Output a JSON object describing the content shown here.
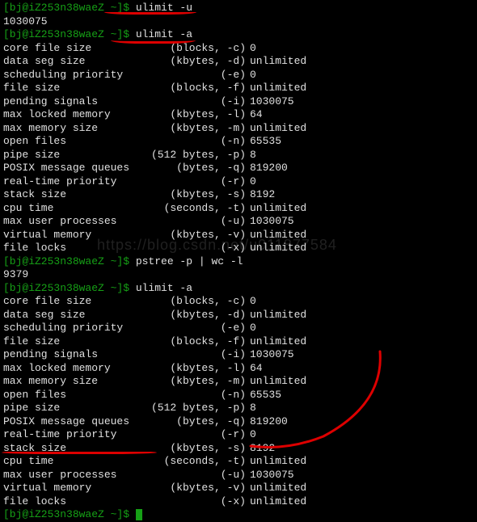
{
  "watermark_text": "https://blog.csdn.net/u011877584",
  "prompts": {
    "p1": {
      "host": "[bj@iZ253n38waeZ ~]$ ",
      "cmd": "ulimit -u"
    },
    "p1_out": "1030075",
    "p2": {
      "host": "[bj@iZ253n38waeZ ~]$ ",
      "cmd": "ulimit -a"
    },
    "p3": {
      "host": "[bj@iZ253n38waeZ ~]$ ",
      "cmd": "pstree -p | wc -l"
    },
    "p3_out": "9379",
    "p4": {
      "host": "[bj@iZ253n38waeZ ~]$ ",
      "cmd": "ulimit -a"
    },
    "p5": {
      "host": "[bj@iZ253n38waeZ ~]$ ",
      "cmd": ""
    }
  },
  "ulimit1": [
    {
      "name": "core file size",
      "unit": "(blocks, -c)",
      "val": "0"
    },
    {
      "name": "data seg size",
      "unit": "(kbytes, -d)",
      "val": "unlimited"
    },
    {
      "name": "scheduling priority",
      "unit": "(-e)",
      "val": "0"
    },
    {
      "name": "file size",
      "unit": "(blocks, -f)",
      "val": "unlimited"
    },
    {
      "name": "pending signals",
      "unit": "(-i)",
      "val": "1030075"
    },
    {
      "name": "max locked memory",
      "unit": "(kbytes, -l)",
      "val": "64"
    },
    {
      "name": "max memory size",
      "unit": "(kbytes, -m)",
      "val": "unlimited"
    },
    {
      "name": "open files",
      "unit": "(-n)",
      "val": "65535"
    },
    {
      "name": "pipe size",
      "unit": "(512 bytes, -p)",
      "val": "8"
    },
    {
      "name": "POSIX message queues",
      "unit": "(bytes, -q)",
      "val": "819200"
    },
    {
      "name": "real-time priority",
      "unit": "(-r)",
      "val": "0"
    },
    {
      "name": "stack size",
      "unit": "(kbytes, -s)",
      "val": "8192"
    },
    {
      "name": "cpu time",
      "unit": "(seconds, -t)",
      "val": "unlimited"
    },
    {
      "name": "max user processes",
      "unit": "(-u)",
      "val": "1030075"
    },
    {
      "name": "virtual memory",
      "unit": "(kbytes, -v)",
      "val": "unlimited"
    },
    {
      "name": "file locks",
      "unit": "(-x)",
      "val": "unlimited"
    }
  ],
  "ulimit2": [
    {
      "name": "core file size",
      "unit": "(blocks, -c)",
      "val": "0"
    },
    {
      "name": "data seg size",
      "unit": "(kbytes, -d)",
      "val": "unlimited"
    },
    {
      "name": "scheduling priority",
      "unit": "(-e)",
      "val": "0"
    },
    {
      "name": "file size",
      "unit": "(blocks, -f)",
      "val": "unlimited"
    },
    {
      "name": "pending signals",
      "unit": "(-i)",
      "val": "1030075"
    },
    {
      "name": "max locked memory",
      "unit": "(kbytes, -l)",
      "val": "64"
    },
    {
      "name": "max memory size",
      "unit": "(kbytes, -m)",
      "val": "unlimited"
    },
    {
      "name": "open files",
      "unit": "(-n)",
      "val": "65535"
    },
    {
      "name": "pipe size",
      "unit": "(512 bytes, -p)",
      "val": "8"
    },
    {
      "name": "POSIX message queues",
      "unit": "(bytes, -q)",
      "val": "819200"
    },
    {
      "name": "real-time priority",
      "unit": "(-r)",
      "val": "0"
    },
    {
      "name": "stack size",
      "unit": "(kbytes, -s)",
      "val": "8192"
    },
    {
      "name": "cpu time",
      "unit": "(seconds, -t)",
      "val": "unlimited"
    },
    {
      "name": "max user processes",
      "unit": "(-u)",
      "val": "1030075"
    },
    {
      "name": "virtual memory",
      "unit": "(kbytes, -v)",
      "val": "unlimited"
    },
    {
      "name": "file locks",
      "unit": "(-x)",
      "val": "unlimited"
    }
  ]
}
